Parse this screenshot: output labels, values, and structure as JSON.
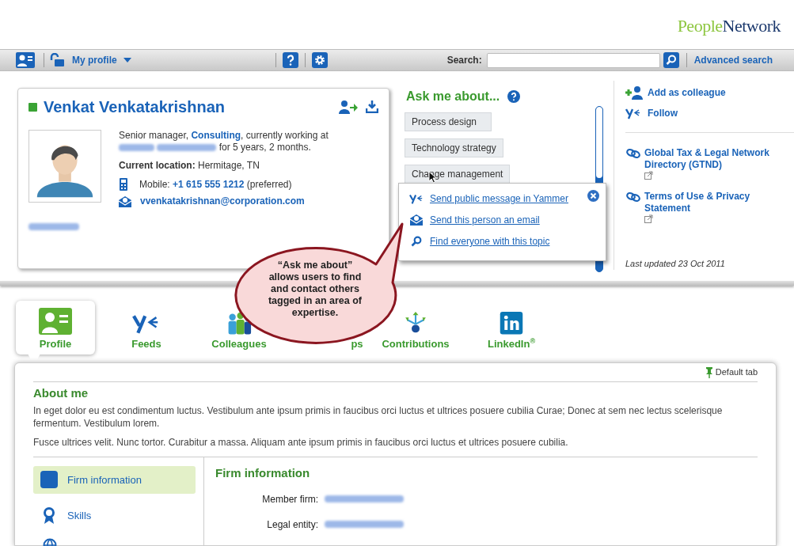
{
  "logo": {
    "part_1": "People",
    "part_2": "Network"
  },
  "toolbar": {
    "profile_menu": "My profile",
    "search_label": "Search:",
    "advanced_search": "Advanced search"
  },
  "profile": {
    "name": "Venkat Venkatakrishnan",
    "summary_lead": "Senior manager,",
    "department": "Consulting",
    "summary_mid": ", currently working at",
    "summary_tail": "for 5 years, 2  months.",
    "location_label": "Current location:",
    "location": "Hermitage, TN",
    "mobile_label": "Mobile:",
    "phone": "+1 615 555 1212",
    "phone_note": "(preferred)",
    "email": "vvenkatakrishnan@corporation.com"
  },
  "ask_me_about": {
    "title": "Ask me about...",
    "topics": [
      "Process design",
      "Technology strategy",
      "Change management"
    ],
    "popup": [
      {
        "kind": "yammer",
        "label": "Send public message in Yammer"
      },
      {
        "kind": "email",
        "label": "Send this person an email"
      },
      {
        "kind": "search",
        "label": "Find everyone with this topic"
      }
    ]
  },
  "actions": [
    {
      "kind": "add",
      "label": "Add as colleague"
    },
    {
      "kind": "follow",
      "label": "Follow"
    }
  ],
  "links": [
    "Global Tax & Legal Network Directory (GTND)",
    "Terms of Use & Privacy Statement"
  ],
  "last_updated": "Last updated 23 Oct 2011",
  "callout": "“Ask me about” allows users to find and contact others tagged in an area of expertise.",
  "tabs": [
    {
      "kind": "profile",
      "label": "Profile",
      "selected": true
    },
    {
      "kind": "feeds",
      "label": "Feeds",
      "selected": false
    },
    {
      "kind": "colleagues",
      "label": "Colleagues",
      "selected": false
    },
    {
      "kind": "groups",
      "label": "ps",
      "selected": false
    },
    {
      "kind": "contributions",
      "label": "Contributions",
      "selected": false
    },
    {
      "kind": "linkedin",
      "label": "LinkedIn$^{®}$",
      "selected": false
    }
  ],
  "default_tab": "Default tab",
  "about": {
    "title": "About me",
    "paragraphs": [
      "In eget dolor eu est condimentum luctus. Vestibulum ante ipsum primis in faucibus orci luctus et ultrices posuere cubilia Curae; Donec at sem nec lectus scelerisque fermentum. Vestibulum lorem.",
      "Fusce ultrices velit. Nunc tortor. Curabitur a massa. Aliquam ante ipsum primis in faucibus orci luctus et ultrices posuere cubilia."
    ]
  },
  "sections": [
    {
      "kind": "firm",
      "label": "Firm information",
      "selected": true
    },
    {
      "kind": "skills",
      "label": "Skills",
      "selected": false
    }
  ],
  "firm_info": {
    "title": "Firm information",
    "fields": [
      "Member firm:",
      "Legal entity:"
    ]
  }
}
